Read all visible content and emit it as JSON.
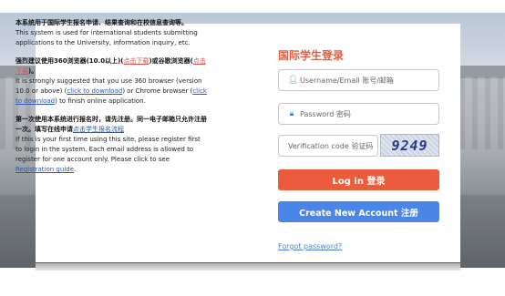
{
  "notice": {
    "p1_zh": "本系统用于国际学生报名申请、结果查询和在校信息查询等。",
    "p1_en": "This system is used for international students submitting applications to the University, information inquiry, etc.",
    "p2_zh_a": "强烈建议使用360浏览器(10.0以上)(",
    "p2_zh_link1": "点击下载",
    "p2_zh_b": ")或谷歌浏览器(",
    "p2_zh_link2": "点击下载",
    "p2_zh_c": ")。",
    "p2_en_a": "It is strongly suggested that you use 360 browser (version 10.0 or above) (",
    "p2_en_link1": "click to download",
    "p2_en_b": ") or Chrome browser (",
    "p2_en_link2": "click to download",
    "p2_en_c": ") to finish online application.",
    "p3_zh_a": "第一次使用本系统进行报名时，请先注册。同一电子邮箱只允许注册一次。填写在线申请",
    "p3_zh_link": "点击学生报名流程",
    "p3_en_a": "If this is your first time using this site, please register first to login in the system. Each email address is allowed to register for one account only. Please click to see ",
    "p3_en_link": "Registration guide",
    "p3_en_b": "."
  },
  "login": {
    "title": "国际学生登录",
    "username_placeholder": "Username/Email 账号/邮箱",
    "password_placeholder": "Password 密码",
    "code_placeholder": "Verification code 验证码",
    "captcha_text": "9249",
    "login_button": "Log in 登录",
    "create_button": "Create New Account 注册",
    "forgot_link": "Forgot password?"
  }
}
